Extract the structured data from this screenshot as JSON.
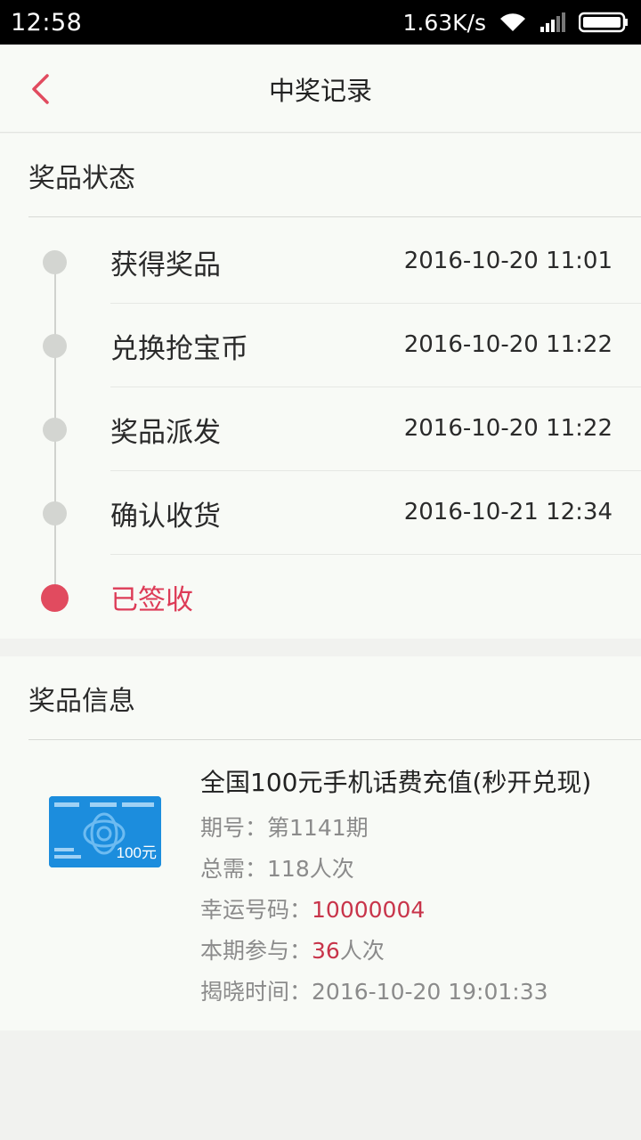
{
  "statusbar": {
    "time": "12:58",
    "speed": "1.63K/s"
  },
  "header": {
    "title": "中奖记录"
  },
  "status_section": {
    "title": "奖品状态",
    "steps": [
      {
        "label": "获得奖品",
        "time": "2016-10-20 11:01"
      },
      {
        "label": "兑换抢宝币",
        "time": "2016-10-20 11:22"
      },
      {
        "label": "奖品派发",
        "time": "2016-10-20 11:22"
      },
      {
        "label": "确认收货",
        "time": "2016-10-21 12:34"
      },
      {
        "label": "已签收",
        "time": ""
      }
    ]
  },
  "info_section": {
    "title": "奖品信息",
    "prize_title": "全国100元手机话费充值(秒开兑现)",
    "period_label": "期号：",
    "period_value": "第1141期",
    "total_label": "总需：",
    "total_value": "118人次",
    "lucky_label": "幸运号码：",
    "lucky_value": "10000004",
    "joined_label": "本期参与：",
    "joined_value": "36",
    "joined_unit": "人次",
    "reveal_label": "揭晓时间：",
    "reveal_value": "2016-10-20 19:01:33",
    "card_amount": "100元"
  },
  "colors": {
    "accent": "#e14b5f",
    "highlight": "#c8344a",
    "card_blue": "#1c8ddd"
  }
}
